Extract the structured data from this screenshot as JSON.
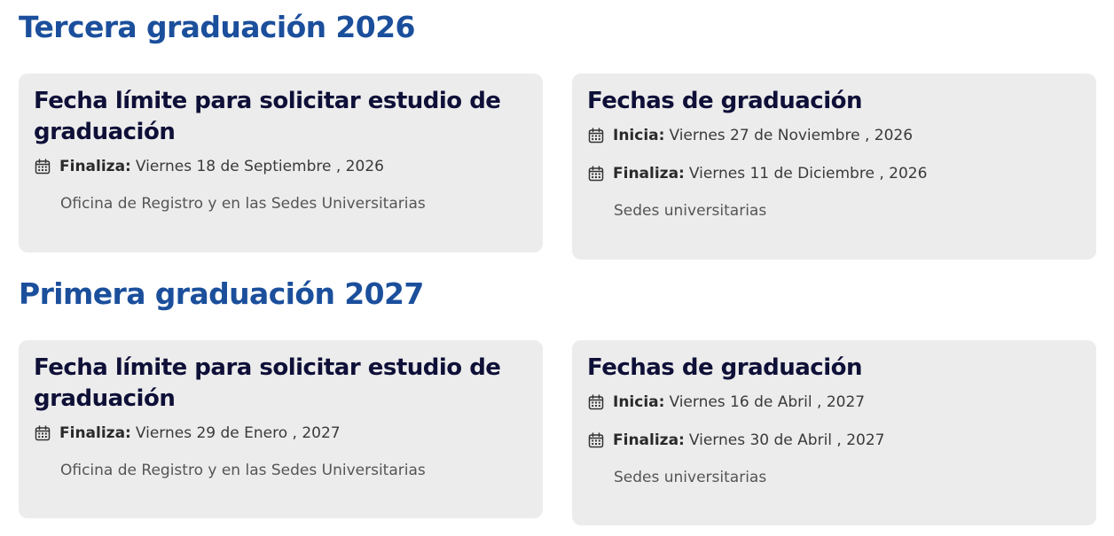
{
  "sections": [
    {
      "title": "Tercera graduación 2026",
      "request_card": {
        "title": "Fecha límite para solicitar estudio de graduación",
        "end_label": "Finaliza:",
        "end_value": "Viernes 18 de Septiembre , 2026",
        "location": "Oficina de Registro y en las Sedes Universitarias"
      },
      "graduation_card": {
        "title": "Fechas de graduación",
        "start_label": "Inicia:",
        "start_value": "Viernes 27 de Noviembre , 2026",
        "end_label": "Finaliza:",
        "end_value": "Viernes 11 de Diciembre , 2026",
        "location": "Sedes universitarias"
      }
    },
    {
      "title": "Primera graduación 2027",
      "request_card": {
        "title": "Fecha límite para solicitar estudio de graduación",
        "end_label": "Finaliza:",
        "end_value": "Viernes 29 de Enero , 2027",
        "location": "Oficina de Registro y en las Sedes Universitarias"
      },
      "graduation_card": {
        "title": "Fechas de graduación",
        "start_label": "Inicia:",
        "start_value": "Viernes 16 de Abril , 2027",
        "end_label": "Finaliza:",
        "end_value": "Viernes 30 de Abril , 2027",
        "location": "Sedes universitarias"
      }
    }
  ],
  "icons": {
    "date": "calendar-icon"
  },
  "colors": {
    "section_title": "#1b4f9c",
    "card_title": "#0f1038",
    "card_background": "#ececec"
  }
}
